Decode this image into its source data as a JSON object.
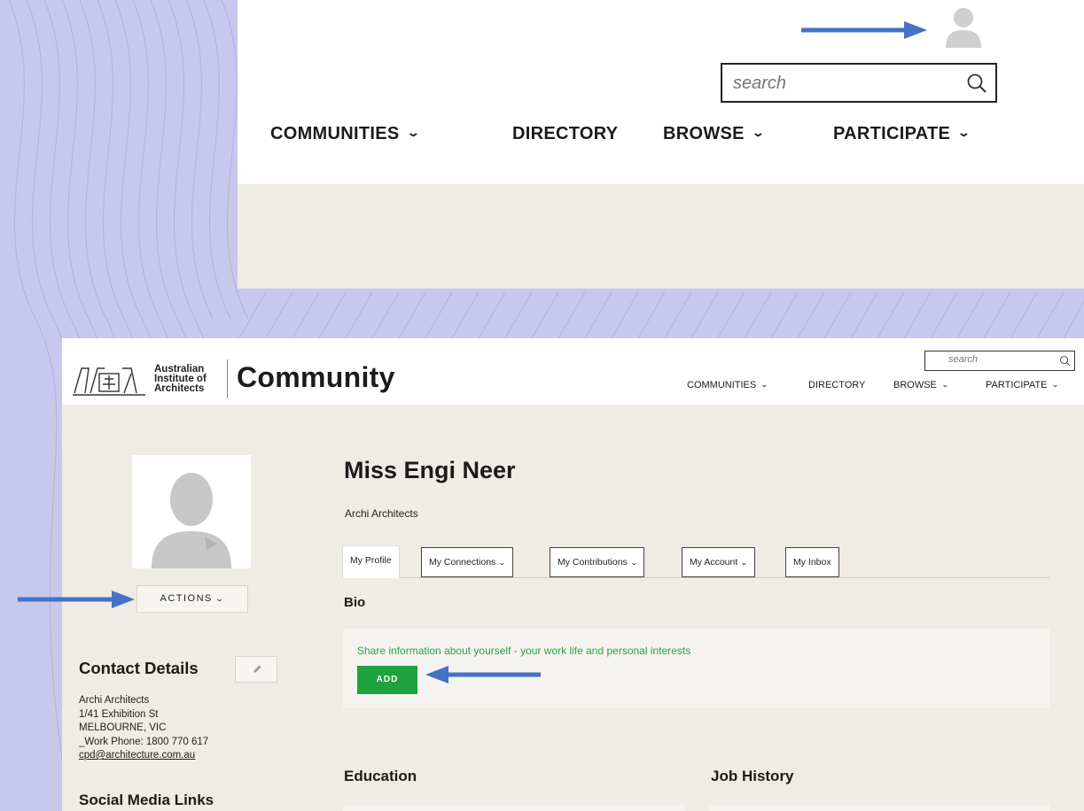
{
  "colors": {
    "arrow": "#4472c4",
    "add_button": "#1ea33f",
    "bio_prompt": "#2ea043",
    "page_bg": "#efebe5",
    "backdrop": "#c9c9ec"
  },
  "inset": {
    "avatar_icon": "user-silhouette-icon",
    "search_placeholder": "search",
    "nav": [
      {
        "label": "COMMUNITIES",
        "has_dropdown": true
      },
      {
        "label": "DIRECTORY",
        "has_dropdown": false
      },
      {
        "label": "BROWSE",
        "has_dropdown": true
      },
      {
        "label": "PARTICIPATE",
        "has_dropdown": true
      }
    ]
  },
  "header": {
    "org_line1": "Australian",
    "org_line2": "Institute of",
    "org_line3": "Architects",
    "site_title": "Community",
    "search_placeholder": "search",
    "nav": [
      {
        "label": "COMMUNITIES",
        "has_dropdown": true
      },
      {
        "label": "DIRECTORY",
        "has_dropdown": false
      },
      {
        "label": "BROWSE",
        "has_dropdown": true
      },
      {
        "label": "PARTICIPATE",
        "has_dropdown": true
      }
    ]
  },
  "sidebar": {
    "actions_label": "ACTIONS",
    "contact_title": "Contact Details",
    "contact_lines": [
      "Archi Architects",
      "1/41 Exhibition St",
      "MELBOURNE, VIC",
      "_Work Phone: 1800 770 617"
    ],
    "contact_email": "cpd@architecture.com.au",
    "social_title": "Social Media Links"
  },
  "profile": {
    "name": "Miss Engi Neer",
    "company": "Archi Architects",
    "tabs": [
      {
        "label": "My Profile",
        "active": true,
        "has_dropdown": false
      },
      {
        "label": "My Connections",
        "active": false,
        "has_dropdown": true
      },
      {
        "label": "My Contributions",
        "active": false,
        "has_dropdown": true
      },
      {
        "label": "My Account",
        "active": false,
        "has_dropdown": true
      },
      {
        "label": "My Inbox",
        "active": false,
        "has_dropdown": false
      }
    ],
    "bio_title": "Bio",
    "bio_prompt": "Share information about yourself - your work life and personal interests",
    "add_label": "ADD",
    "education_title": "Education",
    "job_history_title": "Job History"
  }
}
